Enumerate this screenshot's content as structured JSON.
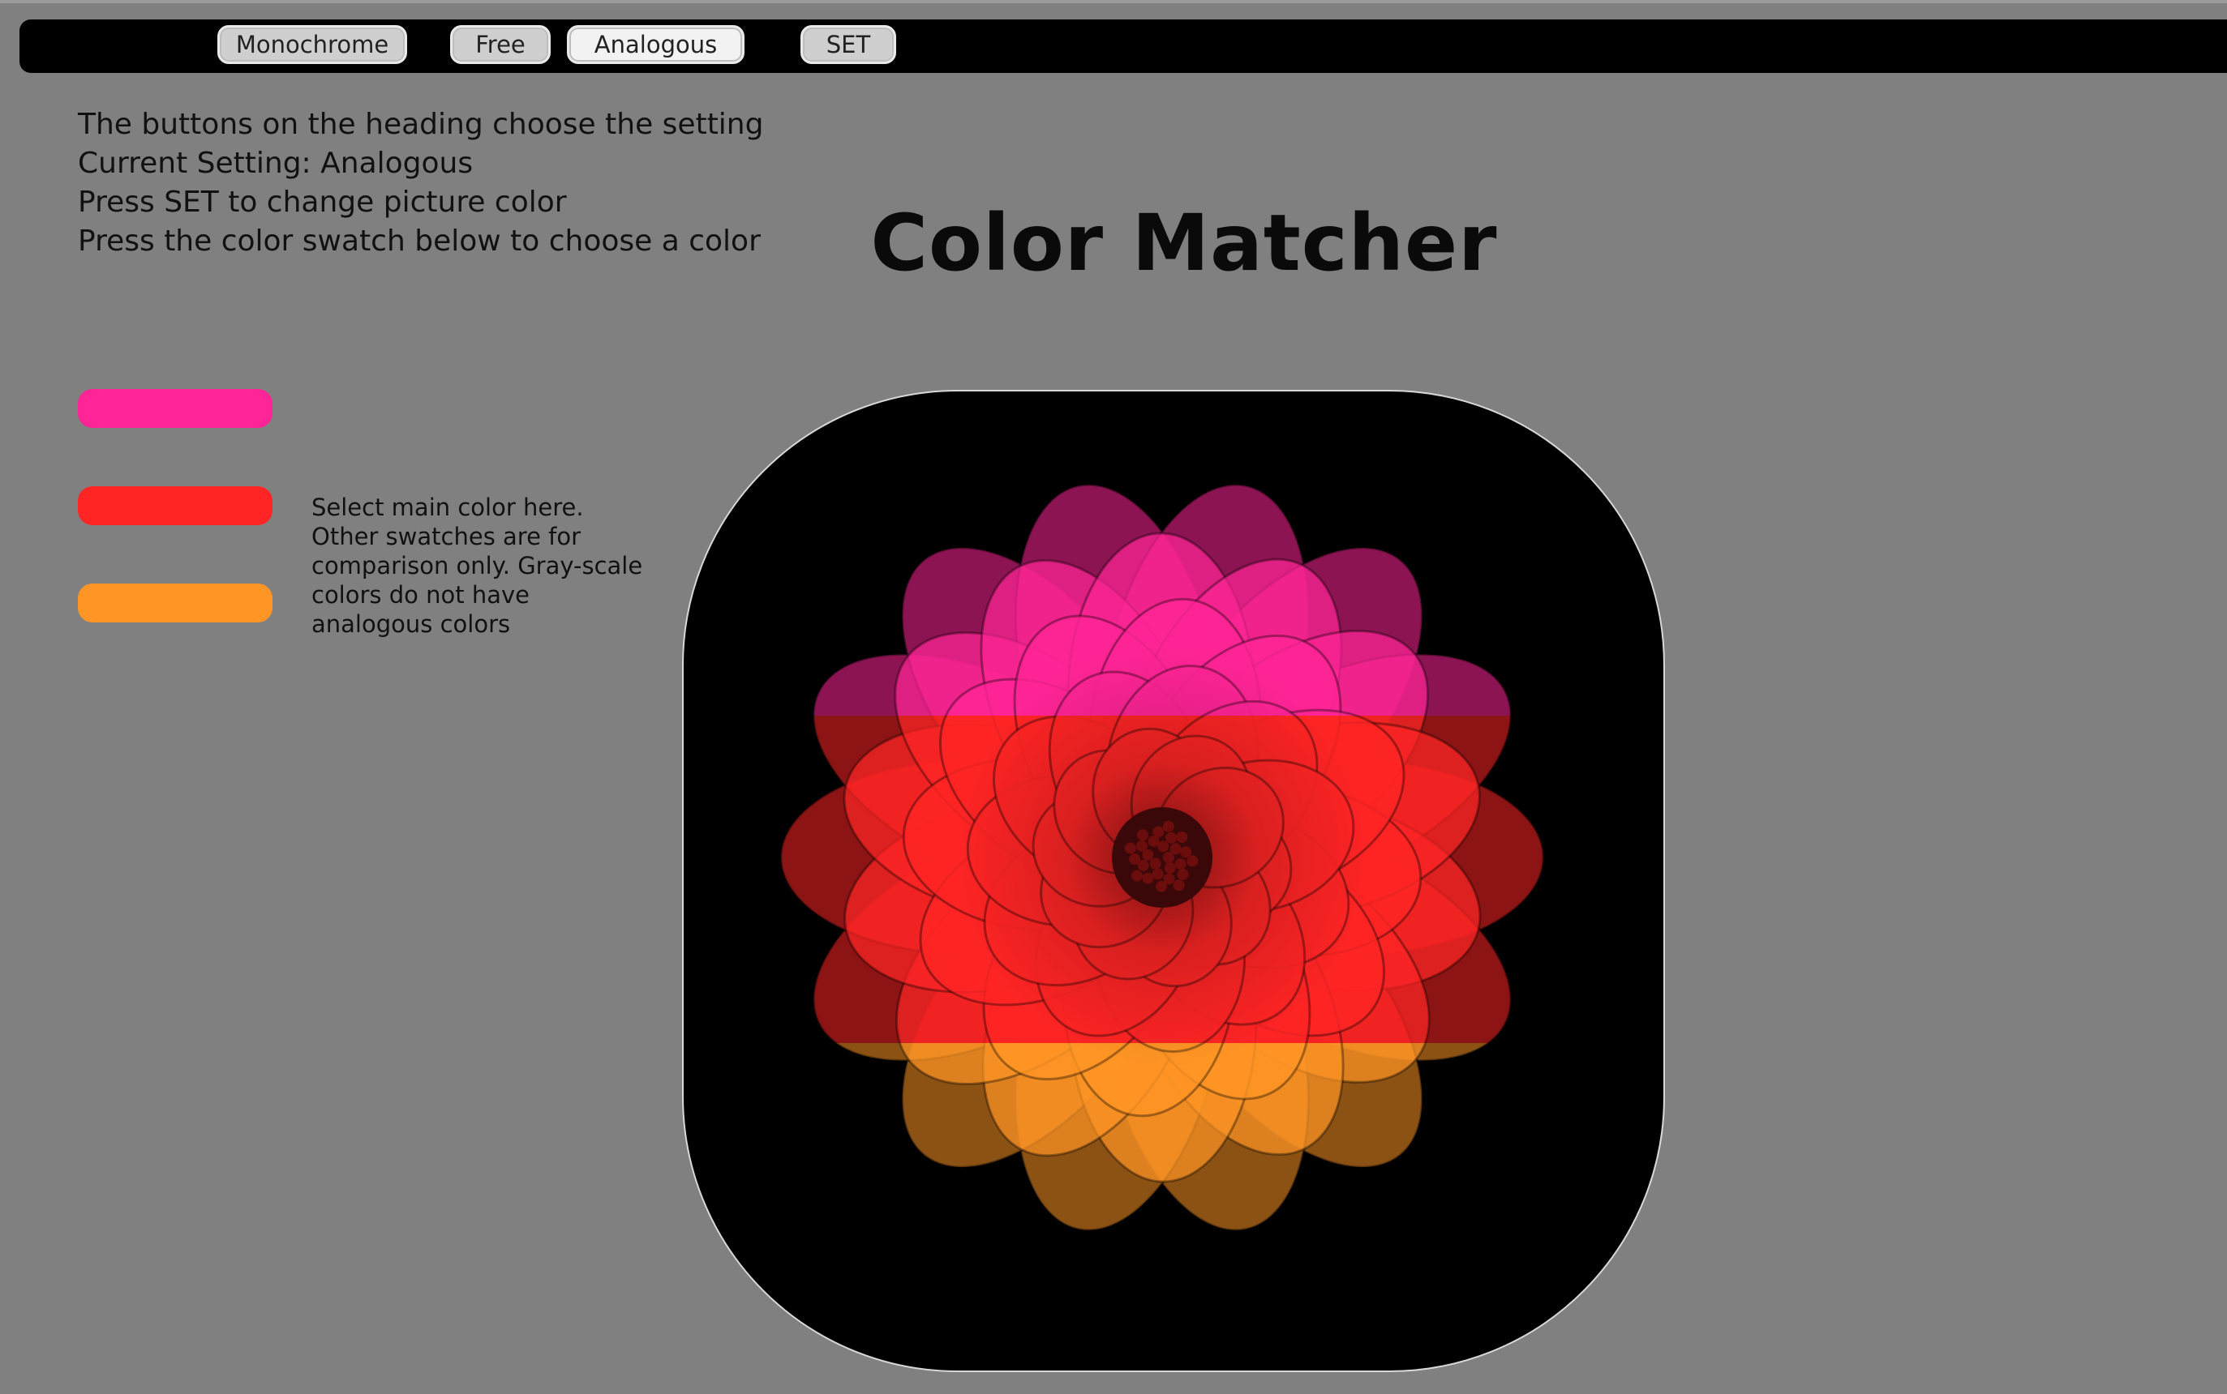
{
  "nav": {
    "buttons": [
      {
        "label": "Monochrome"
      },
      {
        "label": "Free"
      },
      {
        "label": "Analogous"
      },
      {
        "label": "SET"
      }
    ],
    "active": "Analogous"
  },
  "instructions": {
    "line1": "The buttons on the heading choose the setting",
    "line2": "Current Setting: Analogous",
    "line3": "Press SET to change picture color",
    "line4": "Press the color swatch below to choose a color"
  },
  "title": "Color Matcher",
  "swatches": {
    "colors": [
      "#ff2596",
      "#ff2525",
      "#ff9525"
    ],
    "note": "Select main color here. Other swatches are for comparison only. Gray-scale colors do not have analogous colors"
  },
  "picture": {
    "subject": "flower-image",
    "band_colors": [
      "#ff2596",
      "#ff2525",
      "#ff9525"
    ]
  }
}
